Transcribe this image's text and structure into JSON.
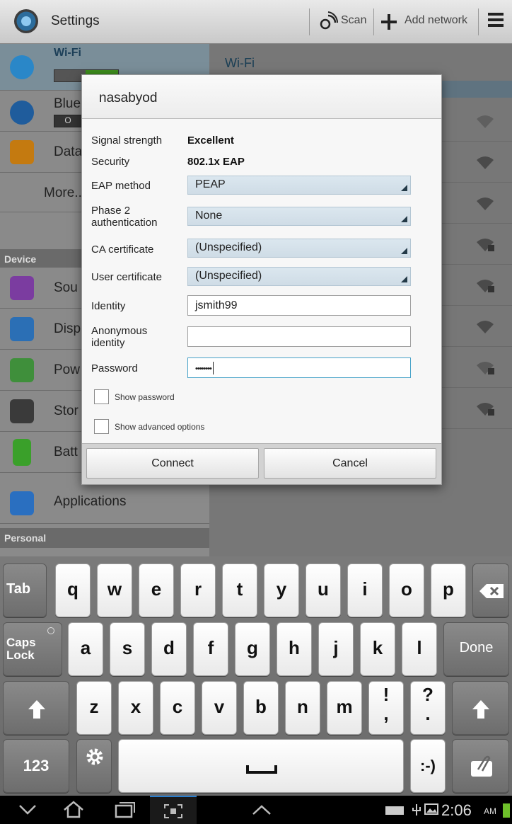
{
  "action_bar": {
    "title": "Settings",
    "scan_label": "Scan",
    "add_network_label": "Add network",
    "icons": {
      "app": "settings-gear-icon",
      "scan": "scan-icon",
      "add": "plus-icon",
      "menu": "overflow-menu-icon"
    }
  },
  "settings_list": {
    "items": [
      {
        "label": "Wi-Fi",
        "icon": "wifi-icon"
      },
      {
        "label": "Blue",
        "icon": "bluetooth-icon"
      },
      {
        "label": "Data",
        "icon": "data-usage-icon"
      },
      {
        "label": "More..."
      }
    ],
    "device_header": "Device",
    "device_items": [
      {
        "label": "Sou",
        "icon": "sound-icon"
      },
      {
        "label": "Disp",
        "icon": "display-icon"
      },
      {
        "label": "Pow",
        "icon": "power-icon"
      },
      {
        "label": "Stor",
        "icon": "storage-icon"
      },
      {
        "label": "Batt",
        "icon": "battery-icon"
      },
      {
        "label": "Applications",
        "icon": "applications-icon"
      }
    ],
    "personal_header": "Personal"
  },
  "wifi_pane": {
    "title": "Wi-Fi"
  },
  "dialog": {
    "network_name": "nasabyod",
    "fields": {
      "signal_strength": {
        "label": "Signal strength",
        "value": "Excellent"
      },
      "security": {
        "label": "Security",
        "value": "802.1x EAP"
      },
      "eap_method": {
        "label": "EAP method",
        "value": "PEAP"
      },
      "phase2": {
        "label_line1": "Phase 2",
        "label_line2": "authentication",
        "value": "None"
      },
      "ca_certificate": {
        "label": "CA certificate",
        "value": "(Unspecified)"
      },
      "user_certificate": {
        "label": "User certificate",
        "value": "(Unspecified)"
      },
      "identity": {
        "label": "Identity",
        "value": "jsmith99"
      },
      "anonymous_identity": {
        "label_line1": "Anonymous",
        "label_line2": "identity",
        "value": ""
      },
      "password": {
        "label": "Password",
        "value": "••••••••"
      }
    },
    "show_password_label": "Show password",
    "show_advanced_label": "Show advanced options",
    "connect_label": "Connect",
    "cancel_label": "Cancel"
  },
  "keyboard": {
    "row1": [
      "q",
      "w",
      "e",
      "r",
      "t",
      "y",
      "u",
      "i",
      "o",
      "p"
    ],
    "row2": [
      "a",
      "s",
      "d",
      "f",
      "g",
      "h",
      "j",
      "k",
      "l"
    ],
    "row3": [
      "z",
      "x",
      "c",
      "v",
      "b",
      "n",
      "m"
    ],
    "tab": "Tab",
    "caps_line1": "Caps",
    "caps_line2": "Lock",
    "done": "Done",
    "punct1_top": "!",
    "punct1_bottom": ",",
    "punct2_top": "?",
    "punct2_bottom": ".",
    "numbers": "123",
    "smiley": ":-)"
  },
  "status_bar": {
    "time": "2:06",
    "ampm": "AM"
  }
}
